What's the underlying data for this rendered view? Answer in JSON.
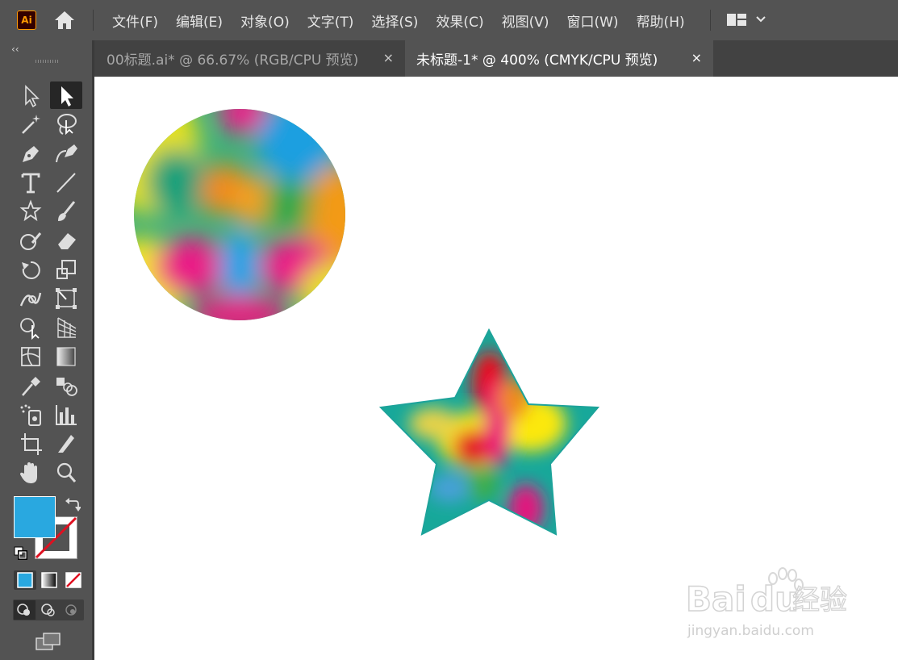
{
  "app": {
    "logo_text": "Ai",
    "accent": "#ff9a00"
  },
  "menu": {
    "items": [
      {
        "label": "文件(F)"
      },
      {
        "label": "编辑(E)"
      },
      {
        "label": "对象(O)"
      },
      {
        "label": "文字(T)"
      },
      {
        "label": "选择(S)"
      },
      {
        "label": "效果(C)"
      },
      {
        "label": "视图(V)"
      },
      {
        "label": "窗口(W)"
      },
      {
        "label": "帮助(H)"
      }
    ]
  },
  "tabs": [
    {
      "title": "00标题.ai* @ 66.67% (RGB/CPU 预览)",
      "close": "×"
    },
    {
      "title": "未标题-1* @ 400% (CMYK/CPU 预览)",
      "close": "×"
    }
  ],
  "toolbar": {
    "collapse_label": "‹‹",
    "tools": [
      {
        "name": "direct-selection-tool",
        "icon": "hollow-arrow-icon"
      },
      {
        "name": "selection-tool",
        "icon": "solid-arrow-icon"
      },
      {
        "name": "magic-wand-tool",
        "icon": "magic-wand-icon"
      },
      {
        "name": "lasso-tool",
        "icon": "lasso-icon"
      },
      {
        "name": "pen-tool",
        "icon": "pen-icon"
      },
      {
        "name": "curvature-tool",
        "icon": "curvature-pen-icon"
      },
      {
        "name": "type-tool",
        "icon": "type-icon"
      },
      {
        "name": "line-tool",
        "icon": "line-icon"
      },
      {
        "name": "star-tool",
        "icon": "star-icon"
      },
      {
        "name": "paintbrush-tool",
        "icon": "brush-icon"
      },
      {
        "name": "shaper-tool",
        "icon": "shaper-icon"
      },
      {
        "name": "eraser-tool",
        "icon": "eraser-icon"
      },
      {
        "name": "rotate-tool",
        "icon": "rotate-icon"
      },
      {
        "name": "scale-tool",
        "icon": "scale-icon"
      },
      {
        "name": "warp-tool",
        "icon": "warp-icon"
      },
      {
        "name": "free-transform-tool",
        "icon": "free-transform-icon"
      },
      {
        "name": "shape-builder-tool",
        "icon": "shape-builder-icon"
      },
      {
        "name": "perspective-grid-tool",
        "icon": "perspective-icon"
      },
      {
        "name": "mesh-tool",
        "icon": "mesh-icon"
      },
      {
        "name": "gradient-tool",
        "icon": "gradient-icon"
      },
      {
        "name": "eyedropper-tool",
        "icon": "eyedropper-icon"
      },
      {
        "name": "blend-tool",
        "icon": "blend-icon"
      },
      {
        "name": "symbol-sprayer-tool",
        "icon": "symbol-sprayer-icon"
      },
      {
        "name": "graph-tool",
        "icon": "bar-graph-icon"
      },
      {
        "name": "artboard-tool",
        "icon": "artboard-icon"
      },
      {
        "name": "slice-tool",
        "icon": "slice-icon"
      },
      {
        "name": "hand-tool",
        "icon": "hand-icon"
      },
      {
        "name": "zoom-tool",
        "icon": "zoom-icon"
      }
    ],
    "fill_color": "#29a8e0",
    "stroke": "none"
  },
  "watermark": {
    "brand_text": "Bai",
    "brand_text2": "du",
    "brand_cn": "经验",
    "url": "jingyan.baidu.com"
  }
}
